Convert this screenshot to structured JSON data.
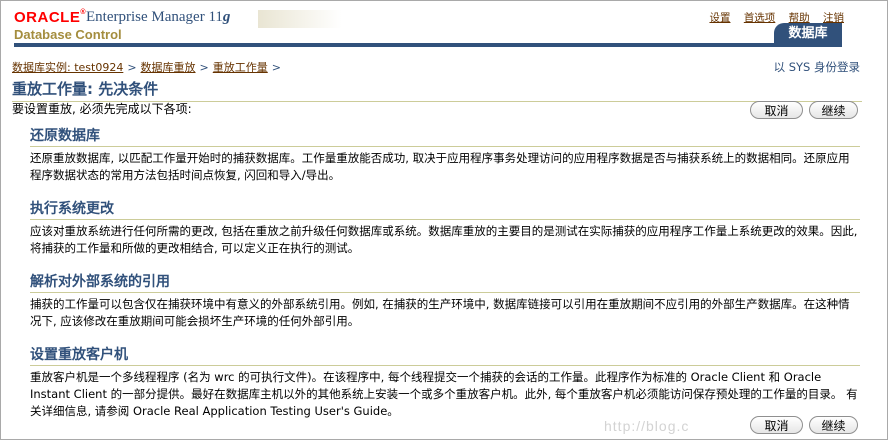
{
  "header": {
    "brand": "ORACLE",
    "product": "Enterprise Manager 11",
    "product_version": "g",
    "subtitle": "Database Control",
    "links": [
      "设置",
      "首选项",
      "帮助",
      "注销"
    ],
    "active_tab": "数据库"
  },
  "breadcrumb": {
    "items": [
      "数据库实例: test0924",
      "数据库重放",
      "重放工作量"
    ],
    "separator": ">"
  },
  "login_status": "以 SYS 身份登录",
  "page": {
    "title": "重放工作量: 先决条件",
    "intro": "要设置重放, 必须先完成以下各项:"
  },
  "buttons": {
    "cancel": "取消",
    "continue": "继续"
  },
  "sections": [
    {
      "heading": "还原数据库",
      "text": "还原重放数据库, 以匹配工作量开始时的捕获数据库。工作量重放能否成功, 取决于应用程序事务处理访问的应用程序数据是否与捕获系统上的数据相同。还原应用程序数据状态的常用方法包括时间点恢复, 闪回和导入/导出。"
    },
    {
      "heading": "执行系统更改",
      "text": "应该对重放系统进行任何所需的更改, 包括在重放之前升级任何数据库或系统。数据库重放的主要目的是测试在实际捕获的应用程序工作量上系统更改的效果。因此, 将捕获的工作量和所做的更改相结合, 可以定义正在执行的测试。"
    },
    {
      "heading": "解析对外部系统的引用",
      "text": "捕获的工作量可以包含仅在捕获环境中有意义的外部系统引用。例如, 在捕获的生产环境中, 数据库链接可以引用在重放期间不应引用的外部生产数据库。在这种情况下, 应该修改在重放期间可能会损坏生产环境的任何外部引用。"
    },
    {
      "heading": "设置重放客户机",
      "text": "重放客户机是一个多线程程序 (名为 wrc 的可执行文件)。在该程序中, 每个线程提交一个捕获的会话的工作量。此程序作为标准的 Oracle Client 和 Oracle Instant Client 的一部分提供。最好在数据库主机以外的其他系统上安装一个或多个重放客户机。此外, 每个重放客户机必须能访问保存预处理的工作量的目录。 有关详细信息, 请参阅 Oracle Real Application Testing User's Guide。"
    }
  ],
  "watermark": "http://blog.c"
}
